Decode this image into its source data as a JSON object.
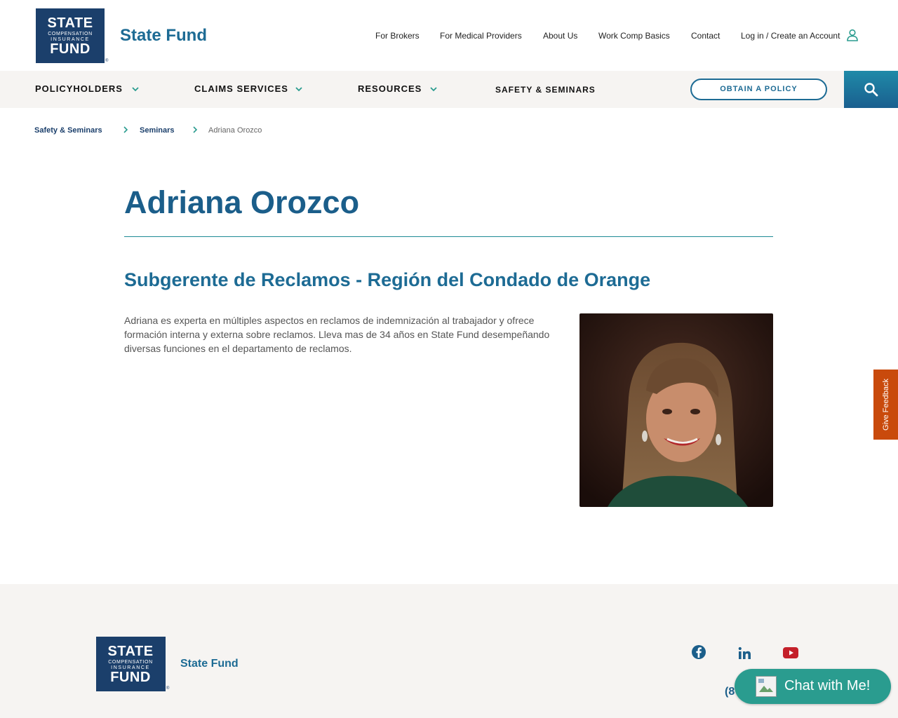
{
  "header": {
    "logo": {
      "line1": "STATE",
      "line2": "COMPENSATION",
      "line3": "INSURANCE",
      "line4": "FUND",
      "reg": "®"
    },
    "brand_name": "State Fund",
    "utility_nav": [
      "For Brokers",
      "For Medical Providers",
      "About Us",
      "Work Comp Basics",
      "Contact",
      "Log in / Create an Account"
    ],
    "user_icon": "person-outline-icon"
  },
  "main_nav": {
    "items": [
      "POLICYHOLDERS",
      "CLAIMS SERVICES",
      "RESOURCES",
      "SAFETY & SEMINARS"
    ],
    "obtain_label": "OBTAIN A POLICY",
    "search_icon": "search-icon"
  },
  "breadcrumb": {
    "items": [
      "Safety & Seminars",
      "Seminars",
      "Adriana Orozco"
    ]
  },
  "content": {
    "title": "Adriana Orozco",
    "subtitle": "Subgerente de Reclamos - Región del Condado de Orange",
    "bio": "Adriana es experta en múltiples aspectos en reclamos de indemnización al trabajador y ofrece formación interna y externa sobre reclamos. Lleva mas de 34 años en State Fund desempeñando diversas funciones en el departamento de reclamos."
  },
  "feedback": {
    "label": "Give Feedback"
  },
  "footer": {
    "brand_name": "State Fund",
    "phone_visible": "(8",
    "social": [
      "facebook-icon",
      "linkedin-icon",
      "youtube-icon"
    ]
  },
  "chat": {
    "label": "Chat with Me!"
  },
  "colors": {
    "primary": "#1d6b94",
    "navy": "#1b3f6b",
    "teal": "#2a9c8f",
    "feedback": "#c94a0c",
    "nav_bg": "#f6f4f2"
  }
}
